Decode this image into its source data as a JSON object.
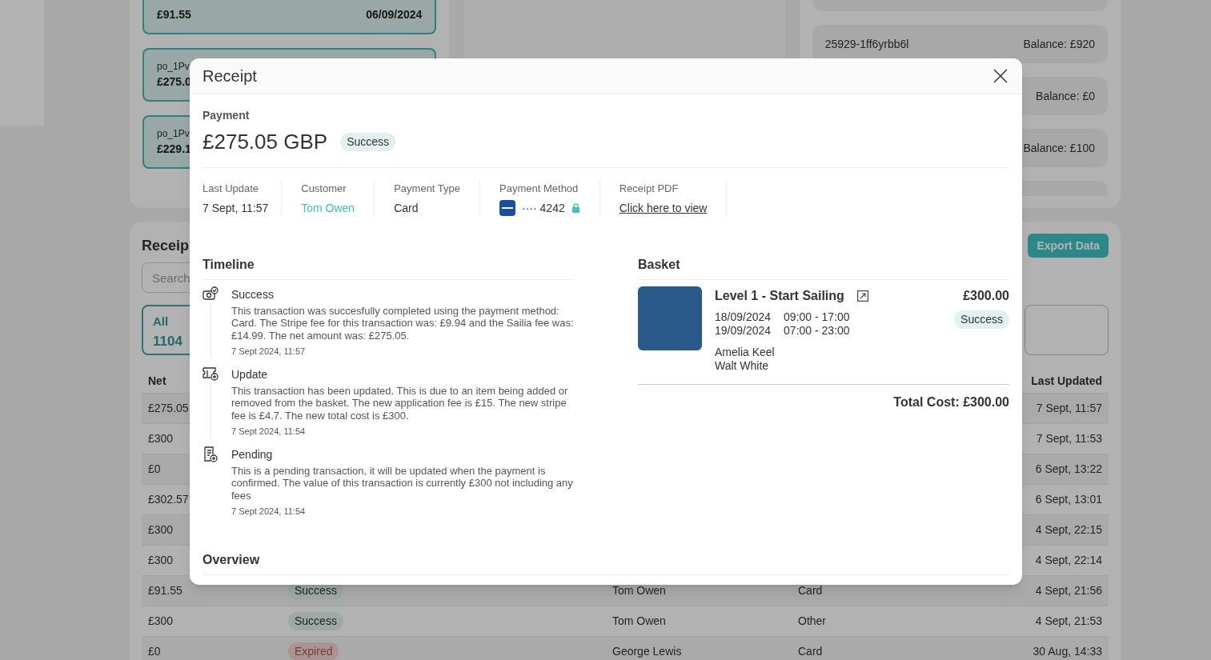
{
  "background": {
    "payout_cards": [
      {
        "amount": "£91.55",
        "date": "06/09/2024"
      },
      {
        "id": "po_1Pv",
        "amount": "£275.0"
      },
      {
        "id": "po_1Pv",
        "amount": "£229.1"
      }
    ],
    "balance_cards": [
      {
        "id": "25929-1ff6yrbb6l",
        "balance": "Balance: £920"
      },
      {
        "balance": "Balance: £0"
      },
      {
        "balance": "Balance: £100"
      }
    ],
    "receipts": {
      "title": "Receip",
      "search_placeholder": "Search",
      "export_button": "Export Data",
      "filters": [
        {
          "label": "All",
          "count": "1104",
          "selected": true
        },
        {
          "selected": false
        }
      ],
      "columns": [
        "Net",
        "Last Updated"
      ],
      "rows": [
        {
          "net": "£275.05",
          "updated": "7 Sept, 11:57"
        },
        {
          "net": "£300",
          "updated": "7 Sept, 11:53"
        },
        {
          "net": "£0",
          "updated": "6 Sept, 13:22"
        },
        {
          "net": "£302.57",
          "updated": "6 Sept, 13:01"
        },
        {
          "net": "£300",
          "updated": "4 Sept, 22:15"
        },
        {
          "net": "£300",
          "updated": "4 Sept, 22:14"
        },
        {
          "net": "£91.55",
          "status": {
            "label": "Success",
            "kind": "success"
          },
          "customer": "Tom Owen",
          "type": "Card",
          "updated": "4 Sept, 21:56"
        },
        {
          "net": "£300",
          "status": {
            "label": "Success",
            "kind": "success"
          },
          "customer": "Tom Owen",
          "type": "Other",
          "updated": "4 Sept, 21:53"
        },
        {
          "net": "£0",
          "status": {
            "label": "Expired",
            "kind": "expired"
          },
          "customer": "George Lewis",
          "type": "Card",
          "updated": "30 Aug, 14:33"
        }
      ]
    }
  },
  "modal": {
    "title": "Receipt",
    "payment": {
      "label": "Payment",
      "amount": "£275.05 GBP",
      "status": {
        "label": "Success",
        "kind": "success"
      }
    },
    "details": [
      {
        "label": "Last Update",
        "value": "7 Sept, 11:57",
        "kind": "text"
      },
      {
        "label": "Customer",
        "value": "Tom Owen",
        "kind": "link"
      },
      {
        "label": "Payment Type",
        "value": "Card",
        "kind": "text"
      },
      {
        "label": "Payment Method",
        "value": "···· 4242",
        "kind": "card"
      },
      {
        "label": "Receipt PDF",
        "value": "Click here to view",
        "kind": "underline"
      }
    ],
    "timeline": {
      "title": "Timeline",
      "events": [
        {
          "kind": "success",
          "title": "Success",
          "description": "This transaction was succesfully completed using the payment method: Card. The Stripe fee for this transaction was: £9.94 and the Sailia fee was: £14.99. The net amount was: £275.05.",
          "time": "7 Sept 2024, 11:57"
        },
        {
          "kind": "update",
          "title": "Update",
          "description": "This transaction has been updated. This is due to an item being added or removed from the basket. The new application fee is £15. The new stripe fee is £4.7. The new total cost is £300.",
          "time": "7 Sept 2024, 11:54"
        },
        {
          "kind": "pending",
          "title": "Pending",
          "description": "This is a pending transaction, it will be updated when the payment is confirmed. The value of this transaction is currently £300 not including any fees",
          "time": "7 Sept 2024, 11:54"
        }
      ]
    },
    "basket": {
      "title": "Basket",
      "items": [
        {
          "name": "Level 1 - Start Sailing",
          "price": "£300.00",
          "status": {
            "label": "Success",
            "kind": "success"
          },
          "sessions": [
            {
              "date": "18/09/2024",
              "time": "09:00 - 17:00"
            },
            {
              "date": "19/09/2024",
              "time": "07:00 - 23:00"
            }
          ],
          "participants": [
            "Amelia Keel",
            "Walt White"
          ]
        }
      ],
      "total": "Total Cost: £300.00"
    },
    "overview": {
      "title": "Overview"
    }
  }
}
